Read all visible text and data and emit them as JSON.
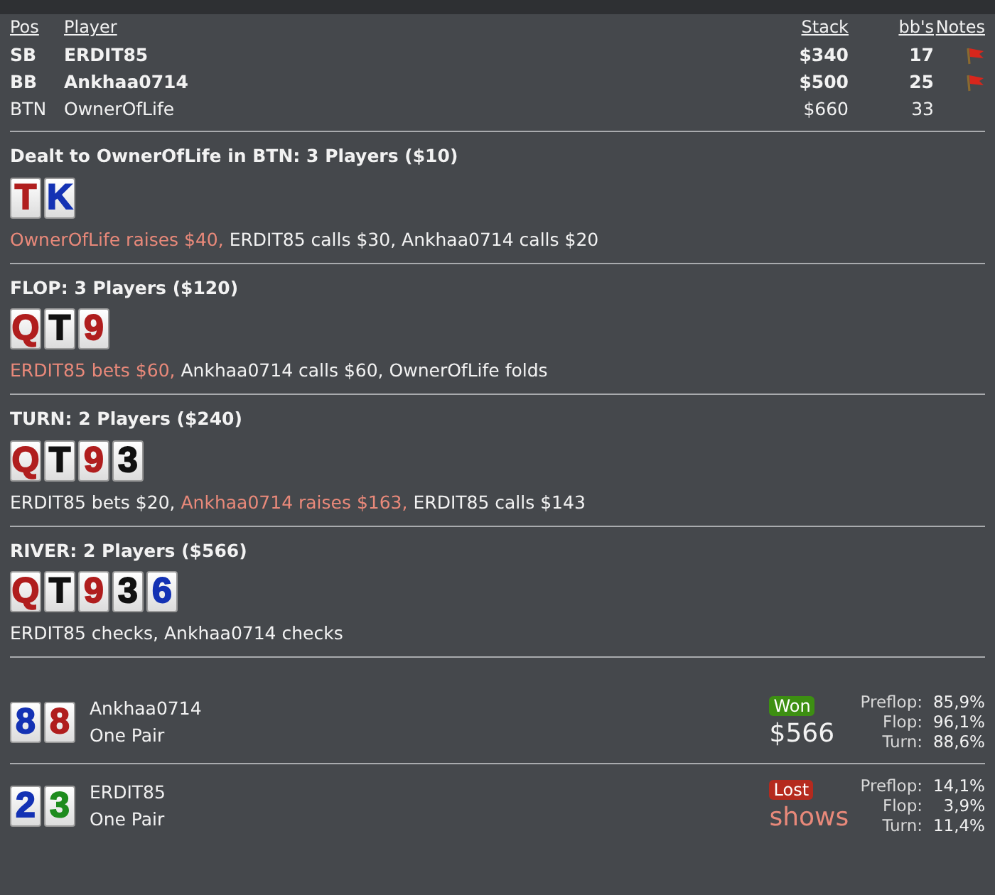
{
  "players_table": {
    "columns": [
      "Pos",
      "Player",
      "Stack",
      "bb's",
      "Notes"
    ],
    "rows": [
      {
        "pos": "SB",
        "player": "ERDIT85",
        "stack": "$340",
        "bbs": "17",
        "bold": true,
        "flagged": true
      },
      {
        "pos": "BB",
        "player": "Ankhaa0714",
        "stack": "$500",
        "bbs": "25",
        "bold": true,
        "flagged": true
      },
      {
        "pos": "BTN",
        "player": "OwnerOfLife",
        "stack": "$660",
        "bbs": "33",
        "bold": false,
        "flagged": false
      }
    ]
  },
  "streets": [
    {
      "title": "Dealt to OwnerOfLife in BTN: 3 Players ($10)",
      "cards": [
        {
          "rank": "T",
          "color": "#b01e1e"
        },
        {
          "rank": "K",
          "color": "#1432b4"
        }
      ],
      "actions": [
        {
          "text": "OwnerOfLife raises $40,",
          "aggressive": true
        },
        {
          "text": "ERDIT85 calls $30,",
          "aggressive": false
        },
        {
          "text": "Ankhaa0714 calls $20",
          "aggressive": false
        }
      ]
    },
    {
      "title": "FLOP: 3 Players ($120)",
      "cards": [
        {
          "rank": "Q",
          "color": "#b01e1e"
        },
        {
          "rank": "T",
          "color": "#111111"
        },
        {
          "rank": "9",
          "color": "#b01e1e"
        }
      ],
      "actions": [
        {
          "text": "ERDIT85 bets $60,",
          "aggressive": true
        },
        {
          "text": "Ankhaa0714 calls $60,",
          "aggressive": false
        },
        {
          "text": "OwnerOfLife folds",
          "aggressive": false
        }
      ]
    },
    {
      "title": "TURN: 2 Players ($240)",
      "cards": [
        {
          "rank": "Q",
          "color": "#b01e1e"
        },
        {
          "rank": "T",
          "color": "#111111"
        },
        {
          "rank": "9",
          "color": "#b01e1e"
        },
        {
          "rank": "3",
          "color": "#111111"
        }
      ],
      "actions": [
        {
          "text": "ERDIT85 bets $20,",
          "aggressive": false
        },
        {
          "text": "Ankhaa0714 raises $163,",
          "aggressive": true
        },
        {
          "text": "ERDIT85 calls $143",
          "aggressive": false
        }
      ]
    },
    {
      "title": "RIVER: 2 Players ($566)",
      "cards": [
        {
          "rank": "Q",
          "color": "#b01e1e"
        },
        {
          "rank": "T",
          "color": "#111111"
        },
        {
          "rank": "9",
          "color": "#b01e1e"
        },
        {
          "rank": "3",
          "color": "#111111"
        },
        {
          "rank": "6",
          "color": "#1432b4"
        }
      ],
      "actions": [
        {
          "text": "ERDIT85 checks,",
          "aggressive": false
        },
        {
          "text": "Ankhaa0714 checks",
          "aggressive": false
        }
      ]
    }
  ],
  "showdown": [
    {
      "cards": [
        {
          "rank": "8",
          "color": "#1432b4"
        },
        {
          "rank": "8",
          "color": "#b01e1e"
        }
      ],
      "player": "Ankhaa0714",
      "hand": "One Pair",
      "badge": "Won",
      "won": true,
      "result": "$566",
      "equity": [
        {
          "label": "Preflop:",
          "value": "85,9%"
        },
        {
          "label": "Flop:",
          "value": "96,1%"
        },
        {
          "label": "Turn:",
          "value": "88,6%"
        }
      ]
    },
    {
      "cards": [
        {
          "rank": "2",
          "color": "#1432b4"
        },
        {
          "rank": "3",
          "color": "#1e8c1e"
        }
      ],
      "player": "ERDIT85",
      "hand": "One Pair",
      "badge": "Lost",
      "won": false,
      "result": "shows",
      "equity": [
        {
          "label": "Preflop:",
          "value": "14,1%"
        },
        {
          "label": "Flop:",
          "value": "3,9%"
        },
        {
          "label": "Turn:",
          "value": "11,4%"
        }
      ]
    }
  ]
}
